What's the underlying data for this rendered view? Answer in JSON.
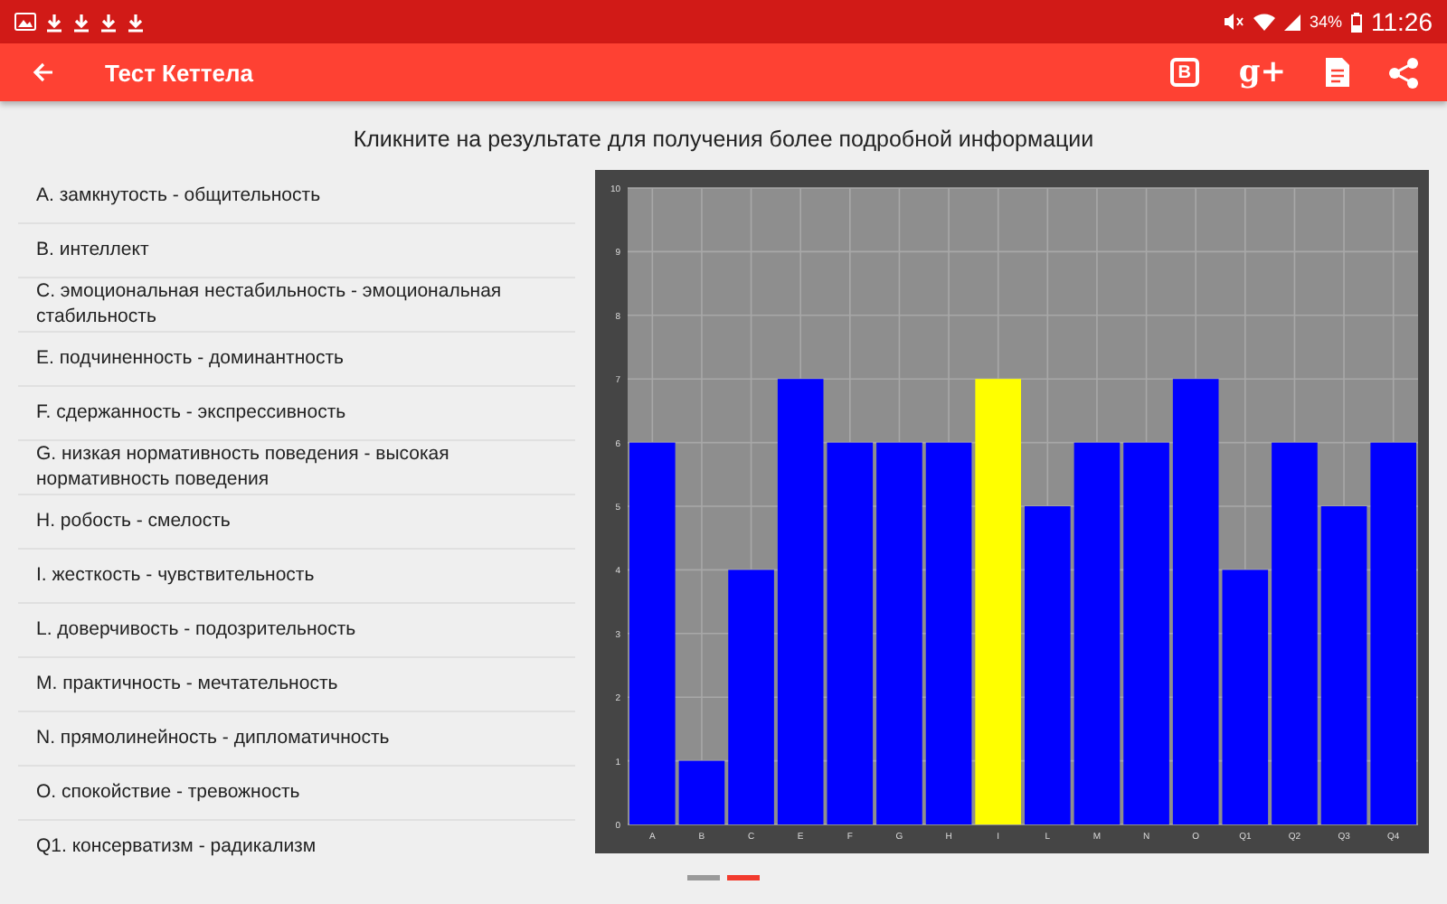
{
  "status_bar": {
    "battery_text": "34%",
    "time": "11:26"
  },
  "toolbar": {
    "title": "Тест Кеттела",
    "vk_label": "B",
    "gplus_label": "g+"
  },
  "heading": "Кликните на результате для получения более подробной информации",
  "factors": [
    {
      "label": "A. замкнутость - общительность"
    },
    {
      "label": "B. интеллект"
    },
    {
      "label": "C. эмоциональная нестабильность - эмоциональная стабильность"
    },
    {
      "label": "E. подчиненность - доминантность"
    },
    {
      "label": "F. сдержанность - экспрессивность"
    },
    {
      "label": "G. низкая нормативность поведения - высокая нормативность поведения"
    },
    {
      "label": "H. робость - смелость"
    },
    {
      "label": "I. жесткость - чувствительность"
    },
    {
      "label": "L. доверчивость - подозрительность"
    },
    {
      "label": "M. практичность - мечтательность"
    },
    {
      "label": "N. прямолинейность - дипломатичность"
    },
    {
      "label": "O. спокойствие - тревожность"
    },
    {
      "label": "Q1. консерватизм - радикализм"
    }
  ],
  "chart": {
    "chart_data": {
      "type": "bar",
      "categories": [
        "A",
        "B",
        "C",
        "E",
        "F",
        "G",
        "H",
        "I",
        "L",
        "M",
        "N",
        "O",
        "Q1",
        "Q2",
        "Q3",
        "Q4"
      ],
      "series": [
        {
          "color": "#0000ff",
          "values": [
            6,
            1,
            4,
            7,
            6,
            6,
            6,
            null,
            5,
            6,
            6,
            7,
            4,
            6,
            5,
            6
          ]
        },
        {
          "color": "#ffff00",
          "values": [
            null,
            null,
            null,
            null,
            null,
            null,
            null,
            7,
            null,
            null,
            null,
            null,
            null,
            null,
            null,
            null
          ]
        }
      ],
      "grid": true,
      "ylim": [
        0,
        10
      ],
      "yticks": [
        0,
        1,
        2,
        3,
        4,
        5,
        6,
        7,
        8,
        9,
        10
      ]
    }
  },
  "pager": [
    {
      "selected": false
    },
    {
      "selected": true
    }
  ]
}
